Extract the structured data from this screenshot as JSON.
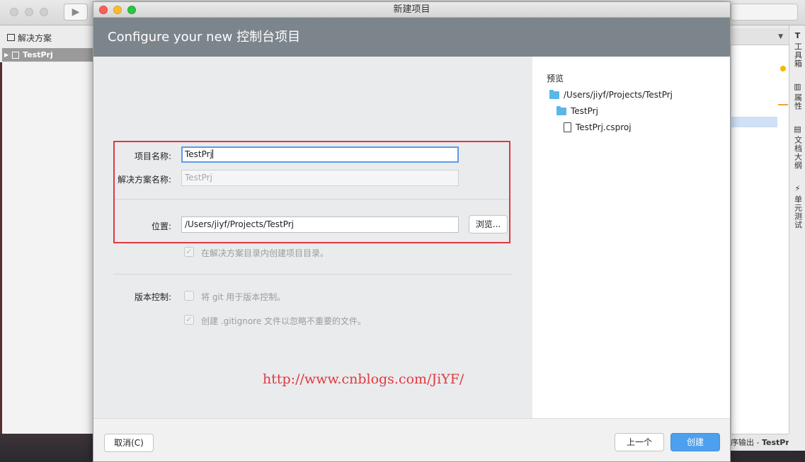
{
  "ide": {
    "solution_header": "解决方案",
    "solution_item": "TestPrj",
    "statusbar_prefix": "序输出 - ",
    "statusbar_project": "TestPrj",
    "side_tabs": [
      {
        "icon": "T",
        "label": "工具箱"
      },
      {
        "icon": "▥",
        "label": "属性"
      },
      {
        "icon": "▤",
        "label": "文档大纲"
      },
      {
        "icon": "⚡",
        "label": "单元测试"
      }
    ]
  },
  "dialog": {
    "window_title": "新建项目",
    "header_title": "Configure your new 控制台项目",
    "project_name_label": "项目名称:",
    "project_name_value": "TestPrj",
    "solution_name_label": "解决方案名称:",
    "solution_name_placeholder": "TestPrj",
    "location_label": "位置:",
    "location_value": "/Users/jiyf/Projects/TestPrj",
    "browse_button": "浏览...",
    "create_dir_check_label": "在解决方案目录内创建项目目录。",
    "vcs_label": "版本控制:",
    "git_check_label": "将 git 用于版本控制。",
    "gitignore_check_label": "创建 .gitignore 文件以忽略不重要的文件。",
    "watermark": "http://www.cnblogs.com/JiYF/",
    "cancel_button": "取消(C)",
    "prev_button": "上一个",
    "create_button": "创建"
  },
  "preview": {
    "title": "预览",
    "tree": [
      {
        "type": "folder",
        "name": "/Users/jiyf/Projects/TestPrj"
      },
      {
        "type": "folder",
        "name": "TestPrj"
      },
      {
        "type": "file",
        "name": "TestPrj.csproj"
      }
    ]
  },
  "colors": {
    "header_bg": "#7c858c",
    "accent_blue": "#4da0ee",
    "highlight_red": "#e0393e",
    "folder_blue": "#5bb8e6"
  }
}
